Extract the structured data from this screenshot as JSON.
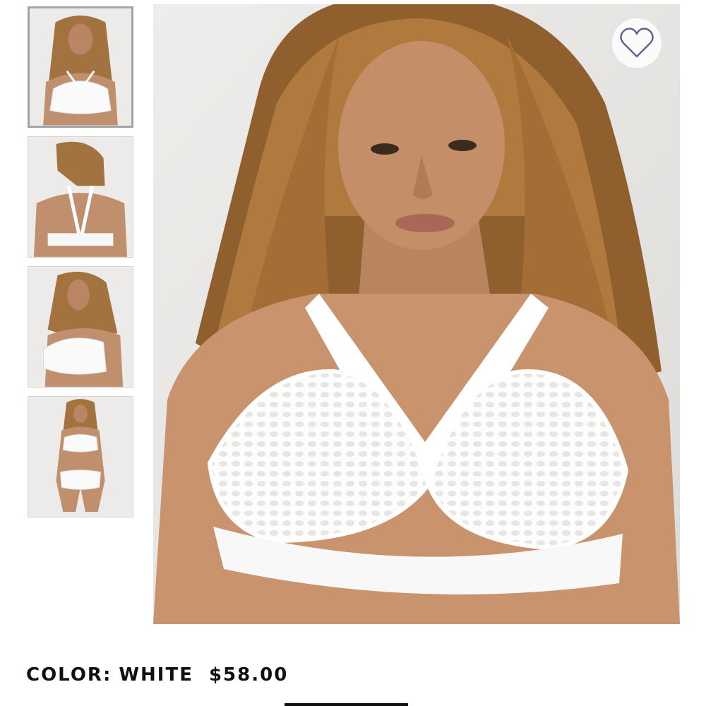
{
  "gallery": {
    "thumbnails": [
      {
        "view": "front",
        "selected": true
      },
      {
        "view": "back",
        "selected": false
      },
      {
        "view": "side",
        "selected": false
      },
      {
        "view": "full-body",
        "selected": false
      }
    ],
    "main_view": "front",
    "wishlist_icon": "heart-outline-icon",
    "accent_color": "#6b5a8e"
  },
  "product": {
    "color_label": "COLOR:",
    "color_value": "WHITE",
    "price": "$58.00"
  }
}
